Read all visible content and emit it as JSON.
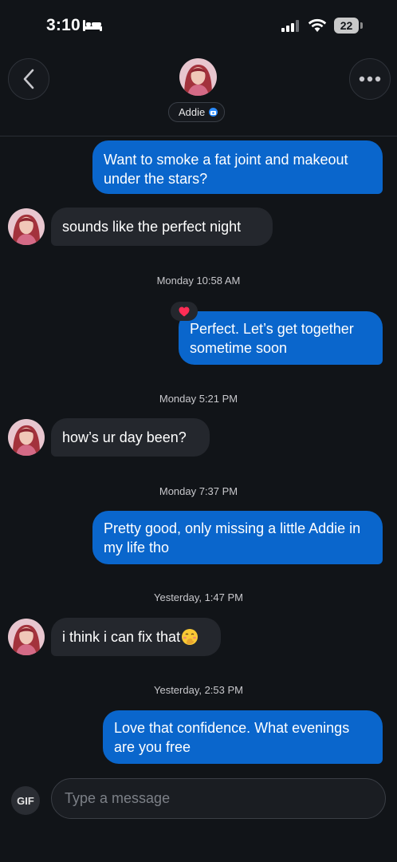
{
  "status_bar": {
    "time": "3:10",
    "battery": "22",
    "icons": [
      "bed-icon",
      "signal-icon",
      "wifi-icon",
      "battery-icon"
    ]
  },
  "header": {
    "contact_name": "Addie",
    "back_icon": "chevron-left-icon",
    "more_icon": "more-horizontal-icon",
    "badge_icon": "verified-camera-icon"
  },
  "messages": [
    {
      "direction": "outgoing",
      "text": "Want to smoke a fat joint and makeout under the stars?"
    },
    {
      "direction": "incoming",
      "text": "sounds like the perfect night"
    },
    {
      "timestamp": "Monday 10:58 AM"
    },
    {
      "direction": "outgoing",
      "text": "Perfect. Let’s get together sometime soon",
      "reaction": "heart-icon"
    },
    {
      "timestamp": "Monday 5:21 PM"
    },
    {
      "direction": "incoming",
      "text": "how’s ur day been?"
    },
    {
      "timestamp": "Monday 7:37 PM"
    },
    {
      "direction": "outgoing",
      "text": "Pretty good, only missing a little Addie in my life tho"
    },
    {
      "timestamp": "Yesterday, 1:47 PM"
    },
    {
      "direction": "incoming",
      "text": "i think i can fix that",
      "emoji": "blushing-hand-over-mouth-emoji"
    },
    {
      "timestamp": "Yesterday, 2:53 PM"
    },
    {
      "direction": "outgoing",
      "text": "Love that confidence. What evenings are you free"
    }
  ],
  "composer": {
    "gif_label": "GIF",
    "placeholder": "Type a message"
  },
  "colors": {
    "background": "#111418",
    "outgoing_bubble": "#0a66cc",
    "incoming_bubble": "#24272d",
    "reaction_heart": "#ff2d55"
  }
}
